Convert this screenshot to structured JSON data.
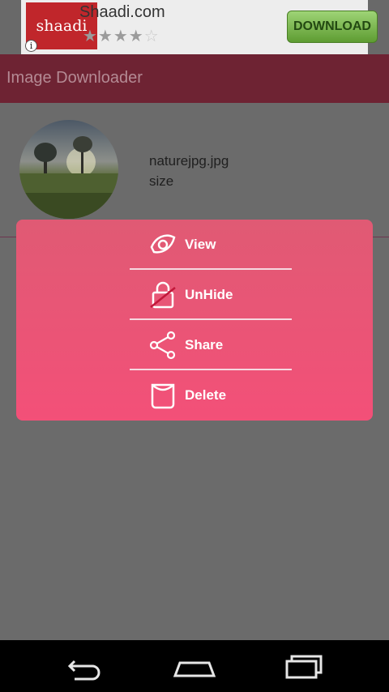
{
  "ad": {
    "logo_text": "shaadi",
    "title": "Shaadi.com",
    "stars_filled": "★★★★",
    "stars_empty": "☆",
    "rating": 4,
    "info_icon": "i",
    "download_label": "DOWNLOAD"
  },
  "appbar": {
    "title": "Image Downloader"
  },
  "item": {
    "name": "naturejpg.jpg",
    "size": "size"
  },
  "menu": [
    {
      "label": "View",
      "icon": "eye-icon"
    },
    {
      "label": "UnHide",
      "icon": "unlock-icon"
    },
    {
      "label": "Share",
      "icon": "share-icon"
    },
    {
      "label": "Delete",
      "icon": "trash-icon"
    }
  ],
  "navbar": {
    "back_icon": "back-icon",
    "home_icon": "home-icon",
    "recents_icon": "recents-icon"
  },
  "colors": {
    "dialog": "#f05074",
    "appbar": "#6e2333",
    "scrim": "#6b6b6b"
  }
}
